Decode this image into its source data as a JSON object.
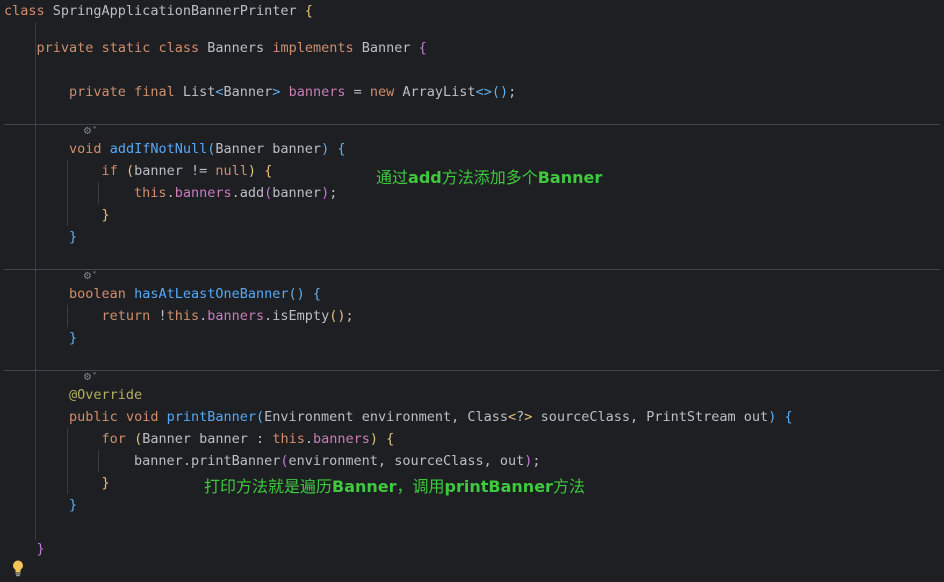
{
  "code": {
    "class_kw": "class",
    "outer_class": "SpringApplicationBannerPrinter",
    "private_kw": "private",
    "static_kw": "static",
    "final_kw": "final",
    "implements_kw": "implements",
    "new_kw": "new",
    "void_kw": "void",
    "boolean_kw": "boolean",
    "if_kw": "if",
    "null_kw": "null",
    "this_kw": "this",
    "return_kw": "return",
    "public_kw": "public",
    "for_kw": "for",
    "inner_class": "Banners",
    "banner_type": "Banner",
    "list_type": "List",
    "arraylist_type": "ArrayList",
    "banners_field": "banners",
    "banner_param": "banner",
    "add_method": "add",
    "method_add_if_not_null": "addIfNotNull",
    "method_has_at_least_one": "hasAtLeastOneBanner",
    "is_empty_method": "isEmpty",
    "override_annotation": "@Override",
    "method_print_banner": "printBanner",
    "environment_type": "Environment",
    "environment_param": "environment",
    "class_type": "Class",
    "wildcard": "?",
    "source_class_param": "sourceClass",
    "printstream_type": "PrintStream",
    "out_param": "out"
  },
  "annotations": {
    "note1_a": "通过",
    "note1_b": "add",
    "note1_c": "方法添加多个",
    "note1_d": "Banner",
    "note2_a": "打印方法就是遍历",
    "note2_b": "Banner",
    "note2_c": "，调用",
    "note2_d": "printBanner",
    "note2_e": "方法"
  },
  "gutter_icons": {
    "method_marker": "gear-sparkle-icon",
    "bulb": "lightbulb-icon"
  },
  "colors": {
    "background": "#1e1f22",
    "text": "#bcbec4",
    "keyword": "#cf8e6d",
    "method_decl": "#56a8f5",
    "field": "#c77dbb",
    "annotation": "#b3ae60",
    "note": "#3ec93e"
  }
}
